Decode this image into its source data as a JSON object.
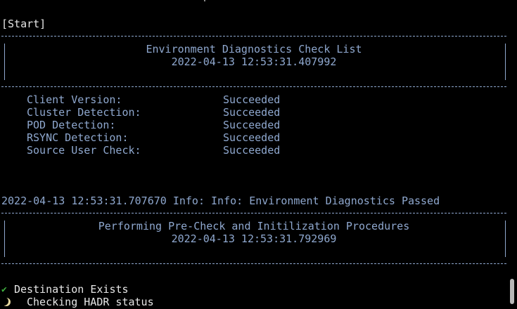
{
  "start_label": "[Start]",
  "env_check": {
    "title": "Environment Diagnostics Check List",
    "timestamp": "2022-04-13 12:53:31.407992",
    "rows": [
      {
        "key": "Client Version:",
        "value": "Succeeded"
      },
      {
        "key": "Cluster Detection:",
        "value": "Succeeded"
      },
      {
        "key": "POD Detection:",
        "value": "Succeeded"
      },
      {
        "key": "RSYNC Detection:",
        "value": "Succeeded"
      },
      {
        "key": "Source User Check:",
        "value": "Succeeded"
      }
    ]
  },
  "info_line": "2022-04-13 12:53:31.707670 Info: Info: Environment Diagnostics Passed",
  "precheck": {
    "title": "Performing Pre-Check and Initilization Procedures",
    "timestamp": "2022-04-13 12:53:31.792969"
  },
  "steps": [
    {
      "icon": "checkmark-icon",
      "label": "Destination Exists"
    },
    {
      "icon": "spinner-icon",
      "label": "Checking HADR status"
    }
  ],
  "colors": {
    "background": "#000000",
    "text_blue": "#8fa8cf",
    "text_white": "#e6e6e6",
    "check_green": "#3fae3f"
  }
}
